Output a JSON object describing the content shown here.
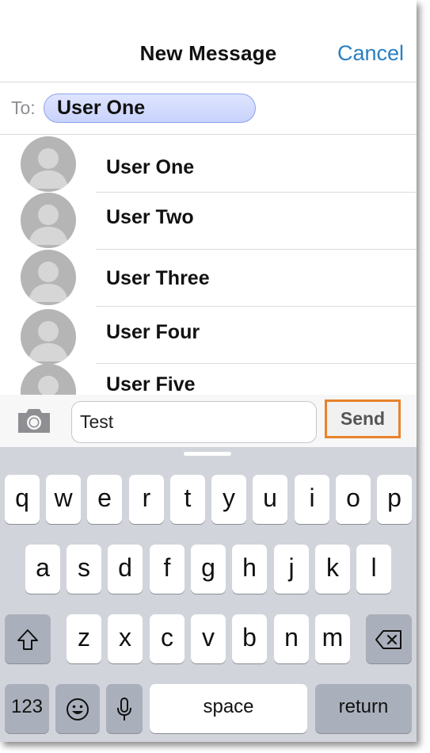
{
  "header": {
    "title": "New Message",
    "cancel_label": "Cancel"
  },
  "to_field": {
    "label": "To:",
    "recipient": "User One"
  },
  "contacts": [
    {
      "name": "User One"
    },
    {
      "name": "User Two"
    },
    {
      "name": "User Three"
    },
    {
      "name": "User Four"
    },
    {
      "name": "User Five"
    }
  ],
  "compose": {
    "message_value": "Test",
    "send_label": "Send",
    "send_highlight_color": "#e8822c"
  },
  "keyboard": {
    "row1": [
      "q",
      "w",
      "e",
      "r",
      "t",
      "y",
      "u",
      "i",
      "o",
      "p"
    ],
    "row2": [
      "a",
      "s",
      "d",
      "f",
      "g",
      "h",
      "j",
      "k",
      "l"
    ],
    "row3": [
      "z",
      "x",
      "c",
      "v",
      "b",
      "n",
      "m"
    ],
    "numbers_label": "123",
    "space_label": "space",
    "return_label": "return"
  },
  "colors": {
    "accent": "#2a7fc1",
    "chip_fill": "#d3dbfd",
    "keyboard_bg": "#d1d4da"
  }
}
